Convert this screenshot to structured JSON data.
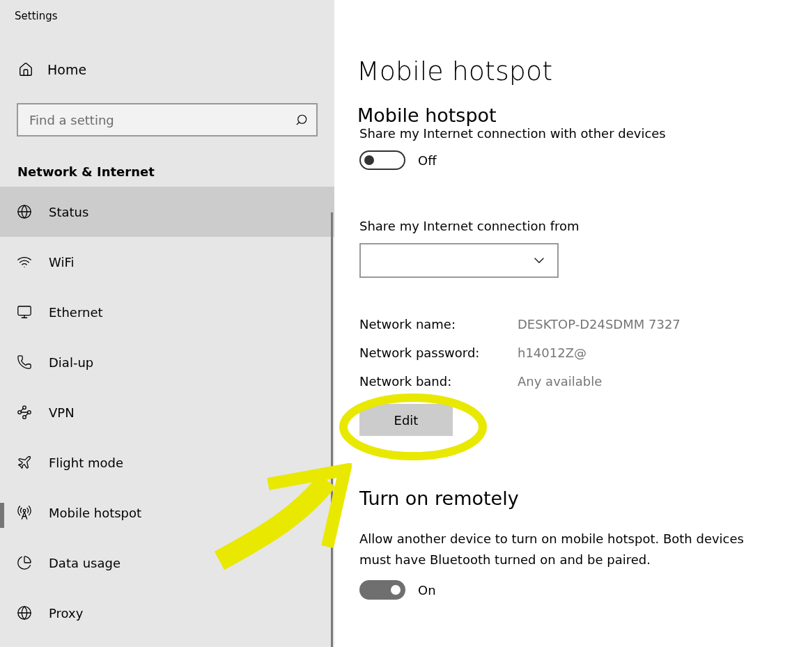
{
  "window": {
    "title": "Settings"
  },
  "sidebar": {
    "home": "Home",
    "search": {
      "placeholder": "Find a setting"
    },
    "section": "Network & Internet",
    "items": [
      {
        "label": "Status",
        "selected": false,
        "highlighted": true
      },
      {
        "label": "WiFi",
        "selected": false,
        "highlighted": false
      },
      {
        "label": "Ethernet",
        "selected": false,
        "highlighted": false
      },
      {
        "label": "Dial-up",
        "selected": false,
        "highlighted": false
      },
      {
        "label": "VPN",
        "selected": false,
        "highlighted": false
      },
      {
        "label": "Flight mode",
        "selected": false,
        "highlighted": false
      },
      {
        "label": "Mobile hotspot",
        "selected": true,
        "highlighted": false
      },
      {
        "label": "Data usage",
        "selected": false,
        "highlighted": false
      },
      {
        "label": "Proxy",
        "selected": false,
        "highlighted": false
      }
    ]
  },
  "page": {
    "title": "Mobile hotspot",
    "section": "Mobile hotspot",
    "share_label": "Share my Internet connection with other devices",
    "share_toggle": {
      "on": false,
      "label": "Off"
    },
    "from_label": "Share my Internet connection from",
    "properties": [
      {
        "name": "Network name:",
        "value": "DESKTOP-D24SDMM 7327"
      },
      {
        "name": "Network password:",
        "value": "h14012Z@"
      },
      {
        "name": "Network band:",
        "value": "Any available"
      }
    ],
    "edit_button": "Edit",
    "remote_title": "Turn on remotely",
    "remote_text": "Allow another device to turn on mobile hotspot. Both devices must have Bluetooth turned on and be paired.",
    "remote_toggle": {
      "on": true,
      "label": "On"
    }
  }
}
